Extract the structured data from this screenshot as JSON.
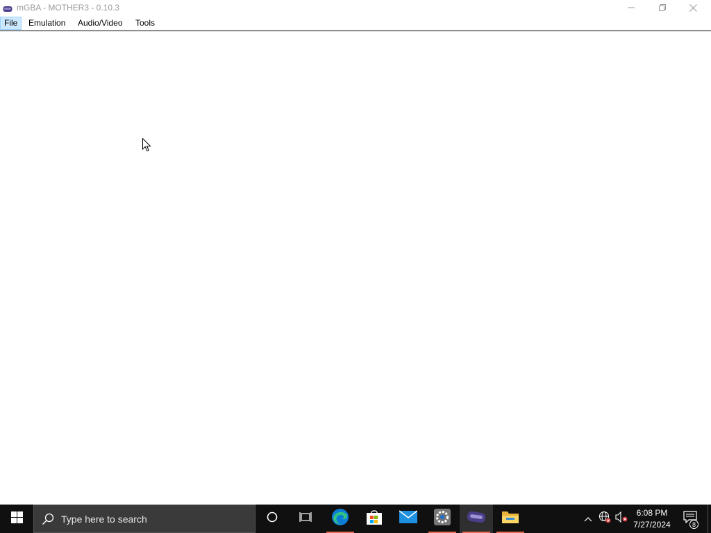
{
  "window": {
    "title": "mGBA - MOTHER3 - 0.10.3",
    "controls": {
      "minimize_icon": "minimize-icon",
      "restore_icon": "restore-icon",
      "close_icon": "close-icon"
    }
  },
  "menubar": {
    "items": [
      {
        "label": "File",
        "active": true
      },
      {
        "label": "Emulation",
        "active": false
      },
      {
        "label": "Audio/Video",
        "active": false
      },
      {
        "label": "Tools",
        "active": false
      }
    ]
  },
  "taskbar": {
    "search_placeholder": "Type here to search",
    "pinned": [
      {
        "icon": "cortana-icon"
      },
      {
        "icon": "task-view-icon"
      },
      {
        "icon": "edge-icon"
      },
      {
        "icon": "microsoft-store-icon"
      },
      {
        "icon": "mail-icon"
      },
      {
        "icon": "settings-icon"
      },
      {
        "icon": "mgba-icon",
        "active": true
      },
      {
        "icon": "file-explorer-icon"
      }
    ],
    "tray": {
      "time": "6:08 PM",
      "date": "7/27/2024",
      "notification_count": "8"
    }
  },
  "colors": {
    "taskbar_bg": "#101010",
    "search_bg": "#3a3a3a",
    "menu_active_bg": "#cce8ff",
    "title_text": "#999999",
    "running_indicator": "#ef6950"
  }
}
